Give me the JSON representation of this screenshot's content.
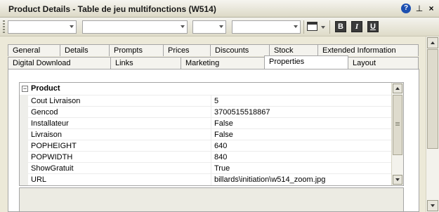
{
  "window": {
    "title": "Product Details - Table de jeu multifonctions (W514)",
    "help_glyph": "?",
    "pin_glyph": "⊥",
    "close_glyph": "×"
  },
  "toolbar": {
    "bold_label": "B",
    "italic_label": "I",
    "underline_label": "U"
  },
  "tabs_top": [
    "General",
    "Details",
    "Prompts",
    "Prices",
    "Discounts",
    "Stock",
    "Extended Information"
  ],
  "tabs_bottom": [
    "Digital Download",
    "Links",
    "Marketing",
    "Properties",
    "Layout"
  ],
  "active_tab": "Properties",
  "property_grid": {
    "group_label": "Product",
    "expand_glyph": "−",
    "rows": [
      {
        "name": "Cout Livraison",
        "value": "5"
      },
      {
        "name": "Gencod",
        "value": "3700515518867"
      },
      {
        "name": "Installateur",
        "value": "False"
      },
      {
        "name": "Livraison",
        "value": "False"
      },
      {
        "name": "POPHEIGHT",
        "value": "640"
      },
      {
        "name": "POPWIDTH",
        "value": "840"
      },
      {
        "name": "ShowGratuit",
        "value": "True"
      },
      {
        "name": "URL",
        "value": "billards\\initiation\\w514_zoom.jpg"
      }
    ]
  },
  "colors": {
    "window_bg": "#ece9d8",
    "help_blue": "#1c4fb0"
  }
}
